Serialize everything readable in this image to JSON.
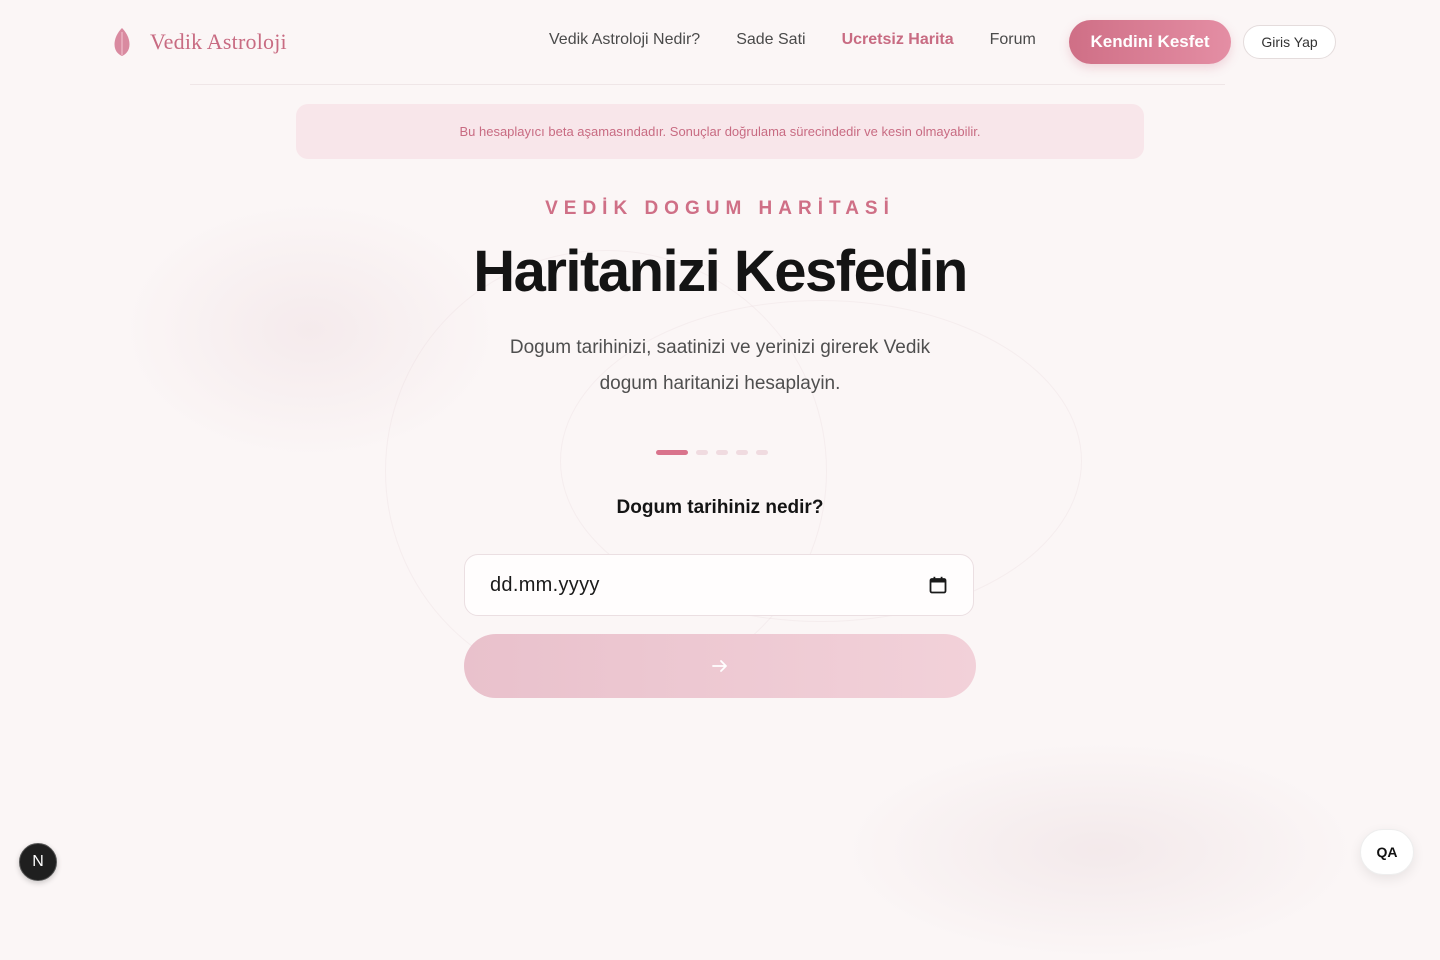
{
  "brand": {
    "name": "Vedik Astroloji",
    "icon": "leaf-icon",
    "color": "#c86b82"
  },
  "nav": {
    "items": [
      {
        "label": "Vedik Astroloji Nedir?",
        "active": false
      },
      {
        "label": "Sade Sati",
        "active": false
      },
      {
        "label": "Ucretsiz Harita",
        "active": true
      },
      {
        "label": "Forum",
        "active": false
      }
    ],
    "cta_label": "Kendini Kesfet",
    "login_label": "Giris Yap"
  },
  "beta_notice": "Bu hesaplayıcı beta aşamasındadır. Sonuçlar doğrulama sürecindedir ve kesin olmayabilir.",
  "hero": {
    "eyebrow": "VEDİK DOGUM HARİTASİ",
    "title": "Haritanizi Kesfedin",
    "subtitle": "Dogum tarihinizi, saatinizi ve yerinizi girerek Vedik dogum haritanizi hesaplayin."
  },
  "progress": {
    "current_step": 1,
    "total_steps": 5
  },
  "form": {
    "question": "Dogum tarihiniz nedir?",
    "date_placeholder": "dd.mm.yyyy",
    "date_icon": "calendar-icon",
    "next_icon": "arrow-right-icon"
  },
  "corner": {
    "n_badge": "N",
    "qa_label": "QA"
  },
  "colors": {
    "accent": "#cf6f86",
    "accent_light": "#e48ea4",
    "background": "#fbf6f6",
    "notice_bg": "#f8e6ea"
  }
}
